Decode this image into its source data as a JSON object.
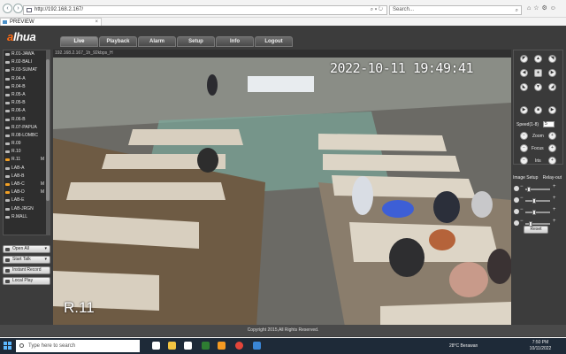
{
  "browser": {
    "url": "http://192.168.2.167/",
    "search_placeholder": "Search...",
    "tab_title": "PREVIEW"
  },
  "app": {
    "logo_prefix": "a",
    "logo_rest": "lhua",
    "menu": [
      "Live",
      "Playback",
      "Alarm",
      "Setup",
      "Info",
      "Logout"
    ],
    "active_menu": "Live"
  },
  "cameras": [
    {
      "label": "R.01-JAWA",
      "active": false,
      "mark": ""
    },
    {
      "label": "R.02-BALI",
      "active": false,
      "mark": ""
    },
    {
      "label": "R.03-SUMAT",
      "active": false,
      "mark": ""
    },
    {
      "label": "R.04-A",
      "active": false,
      "mark": ""
    },
    {
      "label": "R.04-B",
      "active": false,
      "mark": ""
    },
    {
      "label": "R.05-A",
      "active": false,
      "mark": ""
    },
    {
      "label": "R.05-B",
      "active": false,
      "mark": ""
    },
    {
      "label": "R.06-A",
      "active": false,
      "mark": ""
    },
    {
      "label": "R.06-B",
      "active": false,
      "mark": ""
    },
    {
      "label": "R.07-PAPUA",
      "active": false,
      "mark": ""
    },
    {
      "label": "R.08-LOMBC",
      "active": false,
      "mark": ""
    },
    {
      "label": "R.09",
      "active": false,
      "mark": ""
    },
    {
      "label": "R.10",
      "active": false,
      "mark": ""
    },
    {
      "label": "R.11",
      "active": true,
      "mark": "M"
    },
    {
      "label": "LAB-A",
      "active": false,
      "mark": ""
    },
    {
      "label": "LAB-B",
      "active": false,
      "mark": ""
    },
    {
      "label": "LAB-C",
      "active": true,
      "mark": "M"
    },
    {
      "label": "LAB-D",
      "active": true,
      "mark": "M"
    },
    {
      "label": "LAB-E",
      "active": false,
      "mark": ""
    },
    {
      "label": "LAB-JRGN",
      "active": false,
      "mark": ""
    },
    {
      "label": "R.MALL",
      "active": false,
      "mark": ""
    }
  ],
  "controls": {
    "open_all": "Open All",
    "start_talk": "Start Talk",
    "instant_record": "Instant Record",
    "local_play": "Local Play"
  },
  "video": {
    "header": "192.168.2.167_1h_92kbps_H",
    "timestamp": "2022-10-11  19:49:41",
    "camera_label": "R.11"
  },
  "ptz": {
    "speed_label": "Speed(1-8)",
    "speed_value": "5",
    "zoom": "Zoom",
    "focus": "Focus",
    "iris": "Iris"
  },
  "image_setup": {
    "label": "Image Setup",
    "relay": "Relay-out",
    "reset": "Reset"
  },
  "footer": "Copyright 2015,All Rights Reserved.",
  "taskbar": {
    "search_placeholder": "Type here to search",
    "weather": "28°C  Berawan",
    "time": "7:50 PM",
    "date": "10/11/2022"
  }
}
